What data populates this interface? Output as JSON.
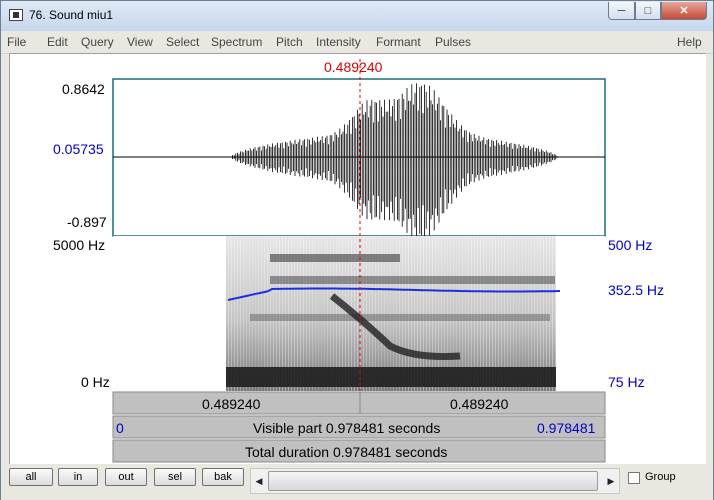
{
  "window": {
    "title": "76. Sound miu1"
  },
  "menu": [
    "File",
    "Edit",
    "Query",
    "View",
    "Select",
    "Spectrum",
    "Pitch",
    "Intensity",
    "Formant",
    "Pulses",
    "Help"
  ],
  "cursor": {
    "time": "0.489240"
  },
  "waveform": {
    "ymax": "0.8642",
    "ymid": "0.05735",
    "ymin": "-0.897"
  },
  "spectrogram": {
    "fmax": "5000 Hz",
    "fmin": "0 Hz"
  },
  "pitch": {
    "max": "500 Hz",
    "current": "352.5 Hz",
    "min": "75 Hz"
  },
  "time_bars": {
    "left_segment": "0.489240",
    "right_segment": "0.489240",
    "start": "0",
    "end": "0.978481",
    "visible_part": "Visible part 0.978481 seconds",
    "total_duration": "Total duration 0.978481 seconds"
  },
  "buttons": {
    "all": "all",
    "in": "in",
    "out": "out",
    "sel": "sel",
    "bak": "bak"
  },
  "group_label": "Group",
  "colors": {
    "cursor": "#e00000",
    "axis_blue": "#0000c8",
    "pitch_line": "#1a2fe0"
  }
}
